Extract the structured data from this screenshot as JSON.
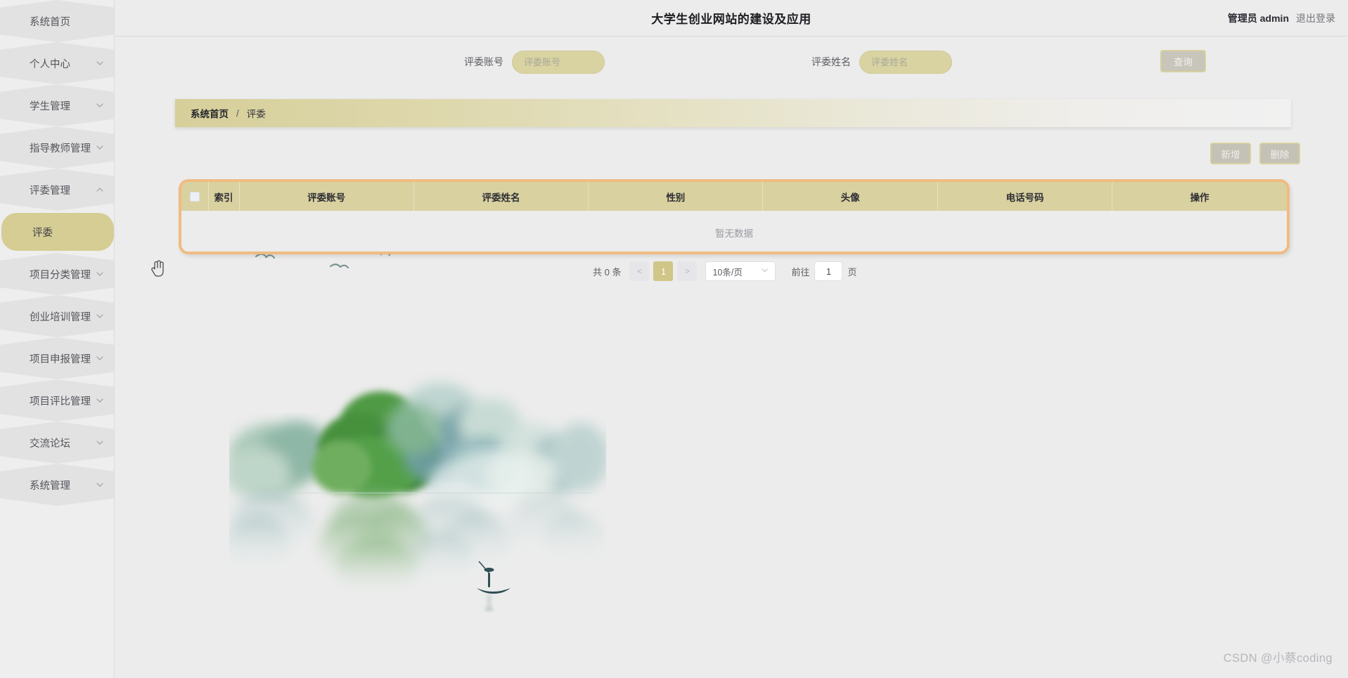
{
  "header": {
    "title": "大学生创业网站的建设及应用",
    "user_label": "管理员 admin",
    "logout_label": "退出登录"
  },
  "sidebar": {
    "items": [
      {
        "label": "系统首页",
        "has_chevron": false,
        "active": false,
        "sub": false
      },
      {
        "label": "个人中心",
        "has_chevron": true,
        "active": false,
        "sub": false
      },
      {
        "label": "学生管理",
        "has_chevron": true,
        "active": false,
        "sub": false
      },
      {
        "label": "指导教师管理",
        "has_chevron": true,
        "active": false,
        "sub": false
      },
      {
        "label": "评委管理",
        "has_chevron": true,
        "active": false,
        "sub": false,
        "expanded": true
      },
      {
        "label": "评委",
        "has_chevron": false,
        "active": true,
        "sub": true
      },
      {
        "label": "项目分类管理",
        "has_chevron": true,
        "active": false,
        "sub": false
      },
      {
        "label": "创业培训管理",
        "has_chevron": true,
        "active": false,
        "sub": false
      },
      {
        "label": "项目申报管理",
        "has_chevron": true,
        "active": false,
        "sub": false
      },
      {
        "label": "项目评比管理",
        "has_chevron": true,
        "active": false,
        "sub": false
      },
      {
        "label": "交流论坛",
        "has_chevron": true,
        "active": false,
        "sub": false
      },
      {
        "label": "系统管理",
        "has_chevron": true,
        "active": false,
        "sub": false
      }
    ]
  },
  "search": {
    "account_label": "评委账号",
    "account_value": "",
    "account_placeholder": "评委账号",
    "name_label": "评委姓名",
    "name_value": "",
    "name_placeholder": "评委姓名",
    "submit_label": "查询"
  },
  "breadcrumb": {
    "root": "系统首页",
    "separator": "/",
    "current": "评委"
  },
  "actions": {
    "add_label": "新增",
    "delete_label": "删除"
  },
  "table": {
    "columns": [
      "索引",
      "评委账号",
      "评委姓名",
      "性别",
      "头像",
      "电话号码",
      "操作"
    ],
    "rows": [],
    "empty_text": "暂无数据"
  },
  "pagination": {
    "total_text": "共 0 条",
    "prev_label": "<",
    "next_label": ">",
    "current_page": "1",
    "page_size_label": "10条/页",
    "goto_label": "前往",
    "goto_value": "1",
    "page_unit": "页"
  },
  "watermark": {
    "text": "CSDN @小蔡coding"
  },
  "colors": {
    "accent": "#d6cd95",
    "table_header": "#d9d1a0",
    "table_border": "#f0bb82",
    "page_bg": "#ececec",
    "sidebar_bg": "#eeeeee"
  }
}
